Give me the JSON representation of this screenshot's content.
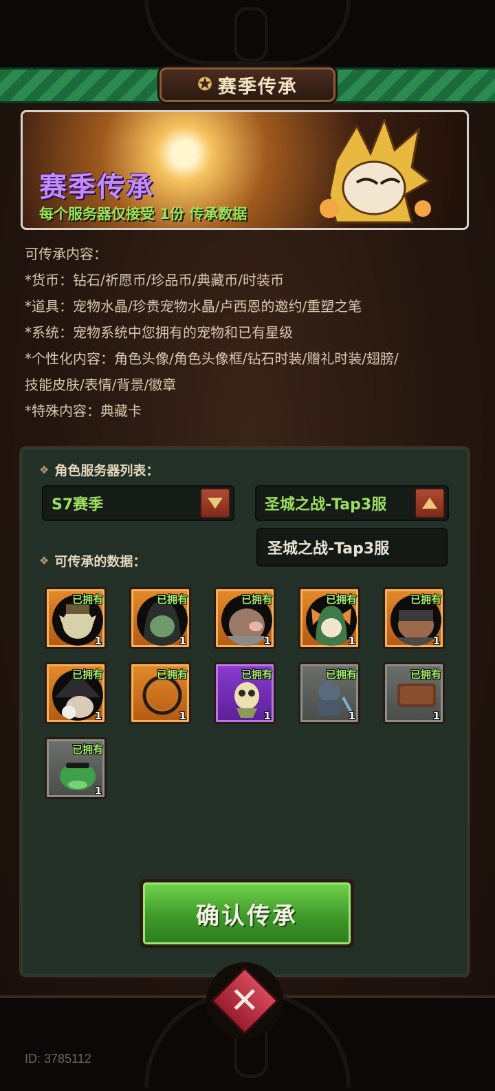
{
  "header": {
    "title": "赛季传承"
  },
  "banner": {
    "title": "赛季传承",
    "subtitle": "每个服务器仅接受 1份 传承数据"
  },
  "description": [
    "可传承内容：",
    "*货币：钻石/祈愿币/珍品币/典藏币/时装币",
    "*道具：宠物水晶/珍贵宠物水晶/卢西恩的邀约/重塑之笔",
    "*系统：宠物系统中您拥有的宠物和已有星级",
    "*个性化内容：角色头像/角色头像框/钻石时装/赠礼时装/翅膀/",
    "技能皮肤/表情/背景/徽章",
    "*特殊内容：典藏卡"
  ],
  "card": {
    "server_list_label": "角色服务器列表：",
    "season_select": "S7赛季",
    "server_select": "圣城之战-Tap3服",
    "server_option": "圣城之战-Tap3服",
    "data_label": "可传承的数据：",
    "items": [
      {
        "owned": "已拥有",
        "count": "1",
        "rarity": "orange"
      },
      {
        "owned": "已拥有",
        "count": "1",
        "rarity": "orange"
      },
      {
        "owned": "已拥有",
        "count": "1",
        "rarity": "orange"
      },
      {
        "owned": "已拥有",
        "count": "1",
        "rarity": "orange"
      },
      {
        "owned": "已拥有",
        "count": "1",
        "rarity": "orange"
      },
      {
        "owned": "已拥有",
        "count": "1",
        "rarity": "orange"
      },
      {
        "owned": "已拥有",
        "count": "1",
        "rarity": "orange"
      },
      {
        "owned": "已拥有",
        "count": "1",
        "rarity": "purple"
      },
      {
        "owned": "已拥有",
        "count": "1",
        "rarity": "grey"
      },
      {
        "owned": "已拥有",
        "count": "1",
        "rarity": "grey"
      },
      {
        "owned": "已拥有",
        "count": "1",
        "rarity": "grey"
      }
    ],
    "confirm_label": "确认传承"
  },
  "footer": {
    "uid": "ID: 3785112"
  },
  "colors": {
    "accent_green": "#9ee05e",
    "banner_title": "#c28cff",
    "orange_frame": "#e58a2a",
    "purple_frame": "#8a3cd0",
    "grey_frame": "#6d6f6c"
  }
}
